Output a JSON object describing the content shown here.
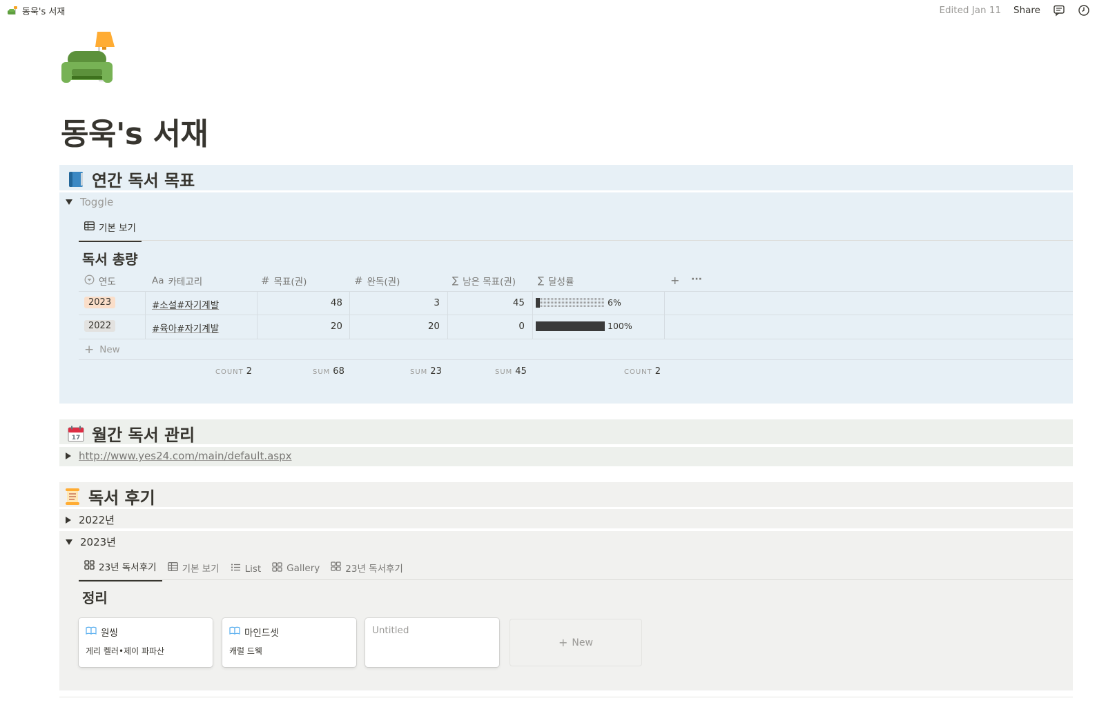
{
  "topbar": {
    "breadcrumb": "동욱's 서재",
    "edited": "Edited Jan 11",
    "share": "Share"
  },
  "page": {
    "title": "동욱's 서재"
  },
  "sections": {
    "annual": {
      "heading": "연간 독서 목표",
      "toggle_label": "Toggle",
      "tab_label": "기본 보기",
      "db_title": "독서 총량",
      "columns": [
        "연도",
        "카테고리",
        "목표(권)",
        "완독(권)",
        "남은 목표(권)",
        "달성률"
      ],
      "column_prefixes": [
        "",
        "Aa",
        "#",
        "#",
        "∑",
        "∑"
      ],
      "rows": [
        {
          "year": "2023",
          "category": "#소설#자기계발",
          "goal": "48",
          "done": "3",
          "remaining": "45",
          "rate_label": "6%",
          "rate": 0.06
        },
        {
          "year": "2022",
          "category": "#육아#자기계발",
          "goal": "20",
          "done": "20",
          "remaining": "0",
          "rate_label": "100%",
          "rate": 1.0
        }
      ],
      "new_label": "New",
      "summary": [
        {
          "key": "COUNT",
          "value": "2"
        },
        {
          "key": "SUM",
          "value": "68"
        },
        {
          "key": "SUM",
          "value": "23"
        },
        {
          "key": "SUM",
          "value": "45"
        },
        {
          "key": "COUNT",
          "value": "2"
        }
      ]
    },
    "monthly": {
      "heading": "월간 독서 관리",
      "link": "http://www.yes24.com/main/default.aspx"
    },
    "reviews": {
      "heading": "독서 후기",
      "toggle_2022": "2022년",
      "toggle_2023": "2023년",
      "tabs": [
        "23년 독서후기",
        "기본 보기",
        "List",
        "Gallery",
        "23년 독서후기"
      ],
      "db_title": "정리",
      "cards": [
        {
          "title": "원씽",
          "subtitle": "게리 켈러•제이 파파산"
        },
        {
          "title": "마인드셋",
          "subtitle": "캐럴 드웩"
        },
        {
          "title": "Untitled",
          "subtitle": ""
        }
      ],
      "new_card_label": "New"
    }
  },
  "colors": {
    "blue_bg": "#e7f0f6",
    "green_bg": "#edf0ec",
    "gray_bg": "#f1f1ef",
    "pill_2023": "#fadec9",
    "pill_2022": "#e3e2e0"
  }
}
